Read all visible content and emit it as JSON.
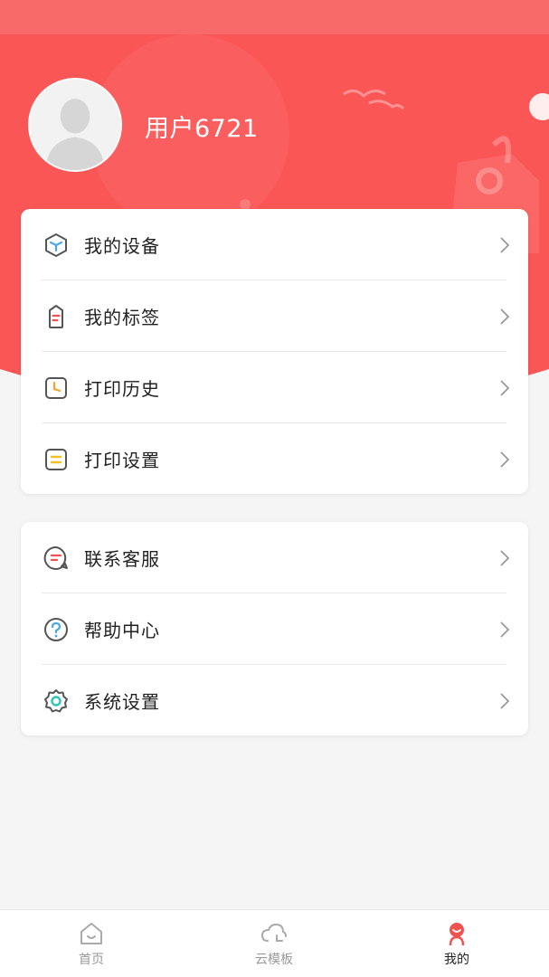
{
  "profile": {
    "username": "用户6721"
  },
  "menu_group_1": [
    {
      "label": "我的设备",
      "icon": "device-cube-icon"
    },
    {
      "label": "我的标签",
      "icon": "label-tag-icon"
    },
    {
      "label": "打印历史",
      "icon": "history-clock-icon"
    },
    {
      "label": "打印设置",
      "icon": "print-settings-icon"
    }
  ],
  "menu_group_2": [
    {
      "label": "联系客服",
      "icon": "customer-service-chat-icon"
    },
    {
      "label": "帮助中心",
      "icon": "help-question-icon"
    },
    {
      "label": "系统设置",
      "icon": "gear-icon"
    }
  ],
  "tabbar": {
    "items": [
      {
        "label": "首页",
        "icon": "home-icon",
        "active": false
      },
      {
        "label": "云模板",
        "icon": "cloud-icon",
        "active": false
      },
      {
        "label": "我的",
        "icon": "profile-icon",
        "active": true
      }
    ]
  },
  "colors": {
    "header": "#fb5656",
    "accent_red": "#f0524f",
    "icon_blue": "#4aa8e8",
    "icon_orange": "#f5a623",
    "icon_teal": "#2ec4b6"
  }
}
